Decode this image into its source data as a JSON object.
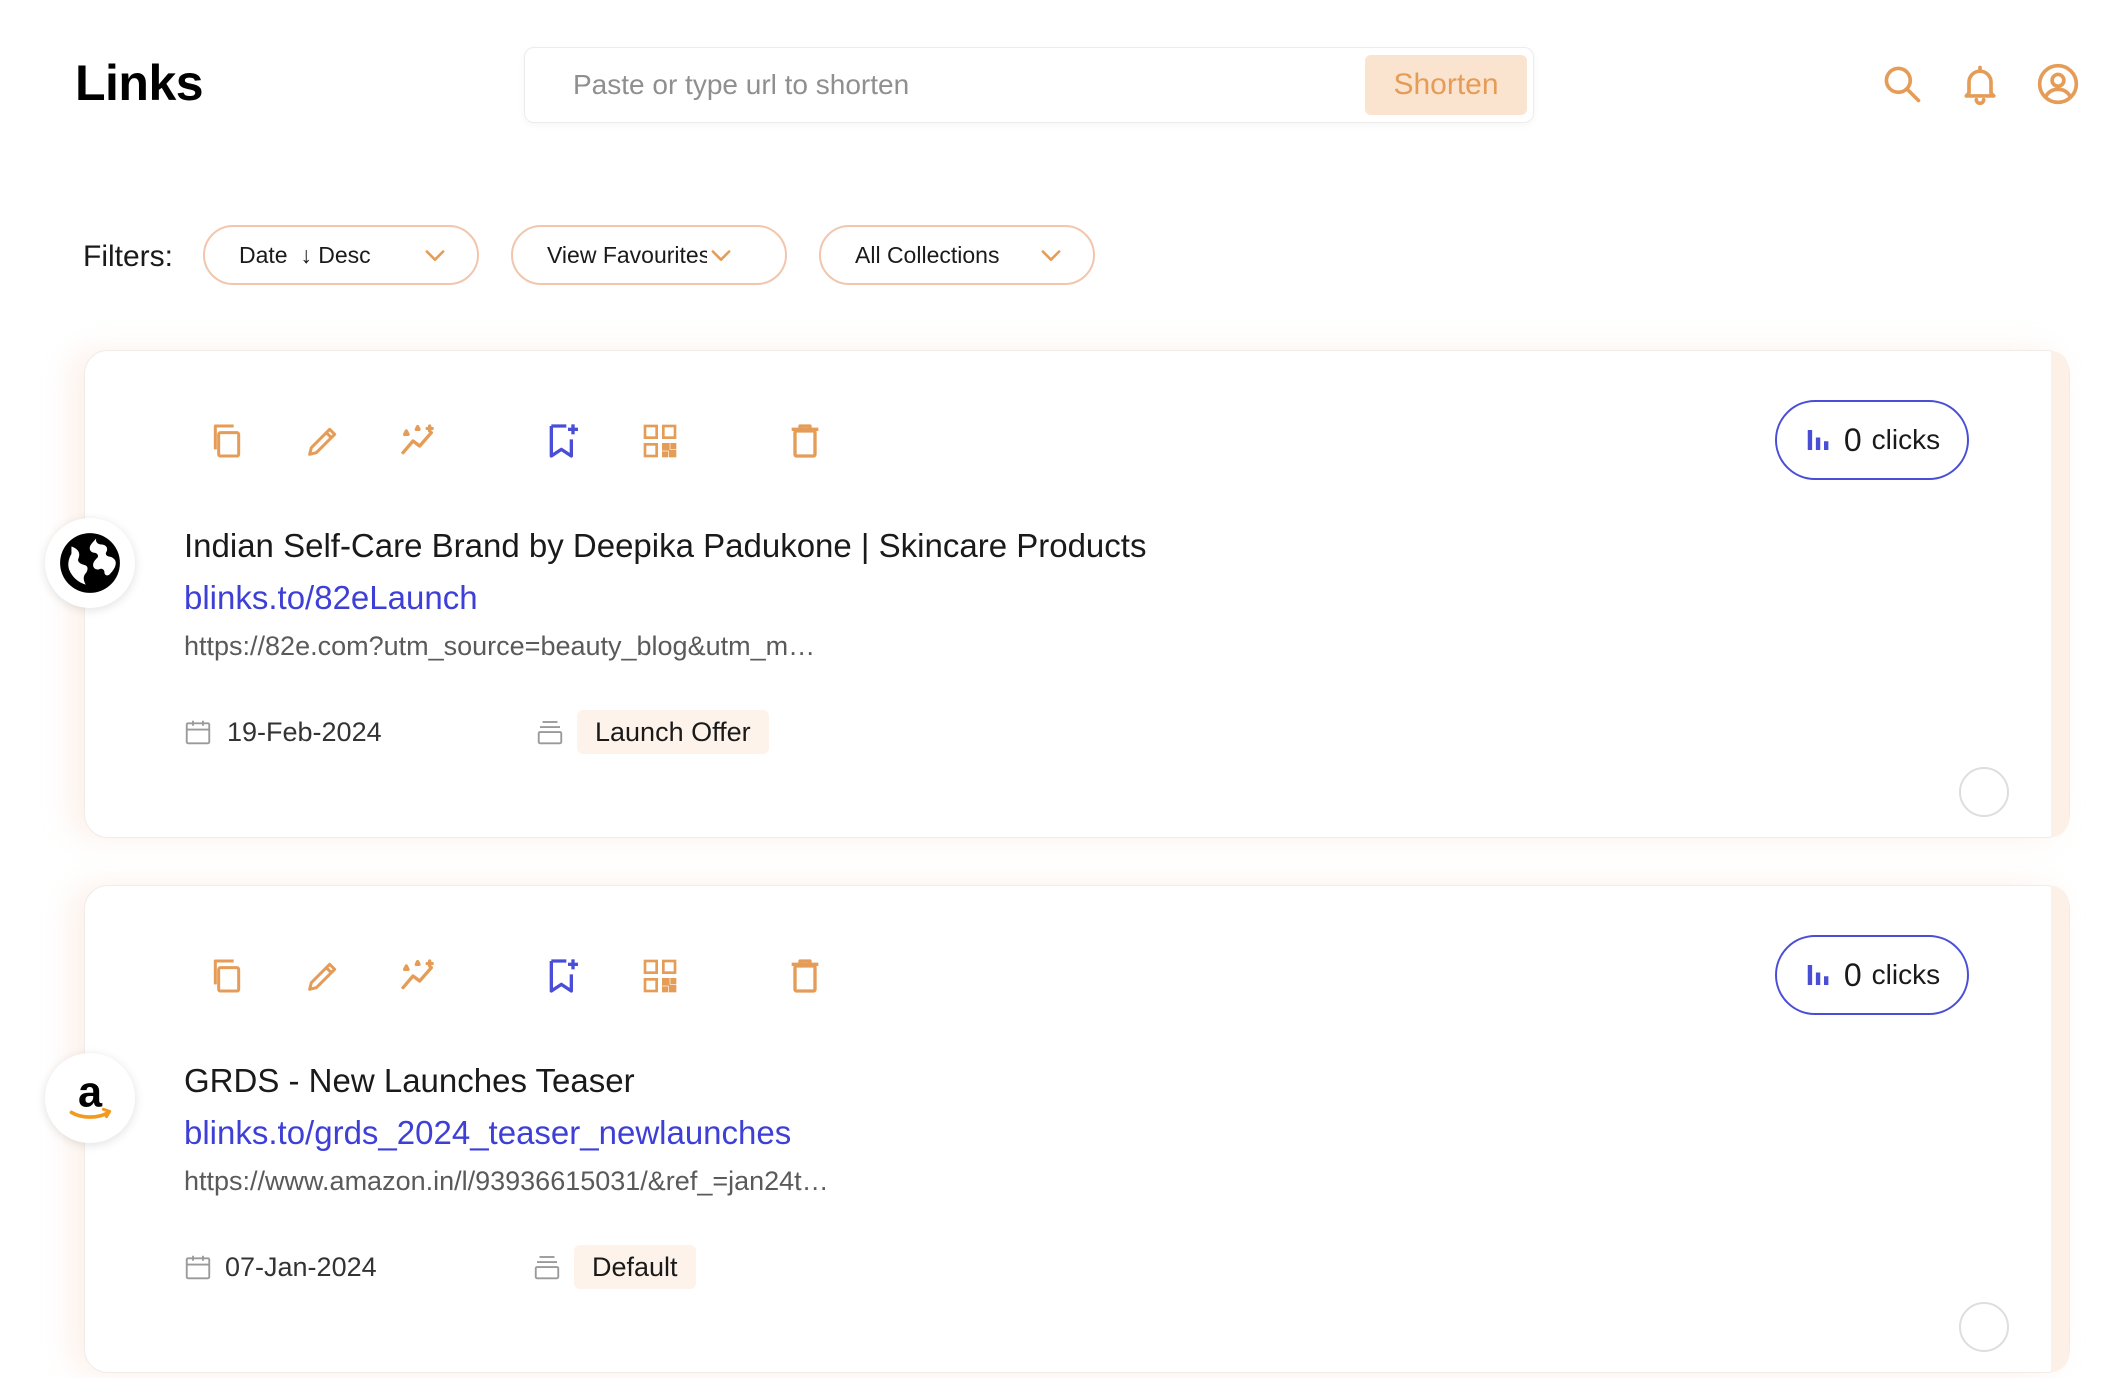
{
  "header": {
    "title": "Links",
    "url_placeholder": "Paste or type url to shorten",
    "url_value": "",
    "shorten_label": "Shorten",
    "icons": [
      "search-icon",
      "bell-icon",
      "user-circle-icon"
    ]
  },
  "filters": {
    "label": "Filters:",
    "sort": "Date  ↓ Desc",
    "favourites": "View Favourites",
    "collections": "All Collections"
  },
  "colors": {
    "accent": "#e59c57",
    "link": "#3d3fd6",
    "tag_bg": "#fdf3ea"
  },
  "cards": [
    {
      "favicon": "globe-icon",
      "clicks": "0",
      "clicks_label": "clicks",
      "title": "Indian Self-Care Brand by Deepika Padukone | Skincare Products",
      "short_link": "blinks.to/82eLaunch",
      "long_url": "https://82e.com?utm_source=beauty_blog&utm_m…",
      "date": "19-Feb-2024",
      "collection": "Launch Offer"
    },
    {
      "favicon": "amazon-icon",
      "clicks": "0",
      "clicks_label": "clicks",
      "title": "GRDS - New Launches Teaser",
      "short_link": "blinks.to/grds_2024_teaser_newlaunches",
      "long_url": "https://www.amazon.in/l/93936615031/&ref_=jan24t…",
      "date": "07-Jan-2024",
      "collection": "Default"
    }
  ]
}
